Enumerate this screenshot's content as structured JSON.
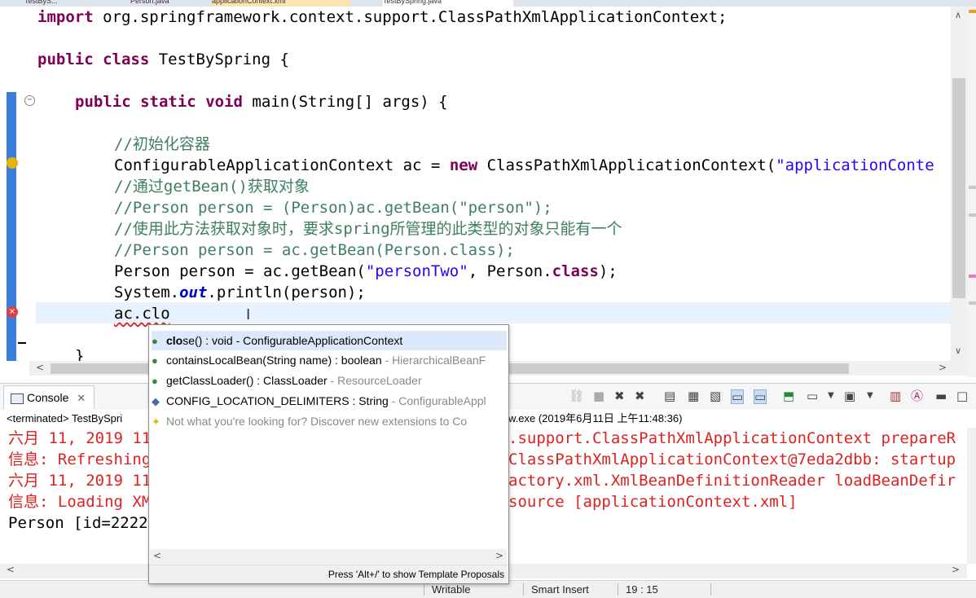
{
  "tabs": [
    {
      "label": "TestByS..."
    },
    {
      "label": "Person.java"
    },
    {
      "label": "applicationContext.xml"
    },
    {
      "label": "TestBySpring.java"
    }
  ],
  "editor": {
    "lines": {
      "l1_kw": "import",
      "l1_rest": " org.springframework.context.support.ClassPathXmlApplicationContext;",
      "l2_kw1": "public",
      "l2_kw2": "class",
      "l2_rest": " TestBySpring {",
      "l3_kw1": "public",
      "l3_kw2": "static",
      "l3_kw3": "void",
      "l3_rest": " main(String[] args) {",
      "c1": "//初始化容器",
      "l5_a": "ConfigurableApplicationContext ac = ",
      "l5_kw": "new",
      "l5_b": " ClassPathXmlApplicationContext(",
      "l5_str": "\"applicationConte",
      "c2": "//通过getBean()获取对象",
      "c3": "//Person person = (Person)ac.getBean(\"person\");",
      "c4": "//使用此方法获取对象时，要求spring所管理的此类型的对象只能有一个",
      "c5": "//Person person = ac.getBean(Person.class);",
      "l10_a": "Person person = ac.getBean(",
      "l10_str": "\"personTwo\"",
      "l10_b": ", Person.",
      "l10_kw": "class",
      "l10_c": ");",
      "l11_a": "System.",
      "l11_it": "out",
      "l11_b": ".println(person);",
      "l12": "ac.clo",
      "l13": "}"
    }
  },
  "content_assist": {
    "proposals": [
      {
        "bold": "clo",
        "main": "se() : void",
        "detail": " - ConfigurableApplicationContext"
      },
      {
        "main": "containsLocalBean(String name) : boolean",
        "detail": " - HierarchicalBeanF"
      },
      {
        "main": "getClassLoader() : ClassLoader",
        "detail": " - ResourceLoader"
      },
      {
        "main": "CONFIG_LOCATION_DELIMITERS : String",
        "detail": " - ConfigurableAppl"
      }
    ],
    "hint": "Not what you're looking for? Discover new extensions to Co",
    "footer": "Press 'Alt+/' to show Template Proposals"
  },
  "console": {
    "tab_label": "Console",
    "description": "<terminated> TestBySpri",
    "description_tail": "w.exe (2019年6月11日 上午11:48:36)",
    "lines": [
      {
        "left": "六月 11, 2019 11",
        "right": ".support.ClassPathXmlApplicationContext prepareR"
      },
      {
        "left": "信息: Refreshing",
        "right": "ClassPathXmlApplicationContext@7eda2dbb: startup"
      },
      {
        "left": "六月 11, 2019 11",
        "right": "actory.xml.XmlBeanDefinitionReader loadBeanDefir"
      },
      {
        "left": "信息: Loading XM",
        "right": "source [applicationContext.xml]"
      },
      {
        "left": "Person [id=2222",
        "right": ""
      }
    ]
  },
  "status": {
    "writable": "Writable",
    "insert_mode": "Smart Insert",
    "position": "19 : 15"
  },
  "colors": {
    "keyword": "#7f0055",
    "comment": "#3f7f5f",
    "string": "#2a00ff",
    "error_text": "#d22222",
    "selection": "#dbe9fb"
  }
}
